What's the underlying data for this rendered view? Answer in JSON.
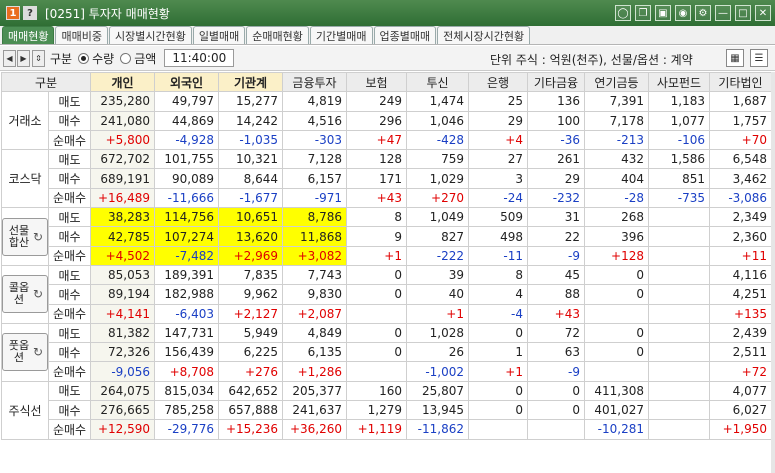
{
  "window": {
    "num_badge": "1",
    "help_badge": "?",
    "title": "[0251] 투자자 매매현황",
    "icons": [
      "lock-icon",
      "copy-icon",
      "save-icon",
      "camera-icon",
      "gear-icon",
      "minimize-icon",
      "maximize-icon",
      "close-icon"
    ]
  },
  "tabs": [
    "매매현황",
    "매매비중",
    "시장별시간현황",
    "일별매매",
    "순매매현황",
    "기간별매매",
    "업종별매매",
    "전체시장시간현황"
  ],
  "toolbar": {
    "gubun_label": "구분",
    "radio_qty": "수량",
    "radio_amount": "금액",
    "time": "11:40:00",
    "unit_text": "단위 주식 : 억원(천주), 선물/옵션 : 계약"
  },
  "table": {
    "columns": [
      "구분",
      "개인",
      "외국인",
      "기관계",
      "금융투자",
      "보험",
      "투신",
      "은행",
      "기타금융",
      "연기금등",
      "사모펀드",
      "기타법인"
    ],
    "row_labels": [
      "매도",
      "매수",
      "순매수"
    ],
    "groups": [
      {
        "name": "거래소",
        "button": false,
        "rows": [
          [
            "235,280",
            "49,797",
            "15,277",
            "4,819",
            "249",
            "1,474",
            "25",
            "136",
            "7,391",
            "1,183",
            "1,687"
          ],
          [
            "241,080",
            "44,869",
            "14,242",
            "4,516",
            "296",
            "1,046",
            "29",
            "100",
            "7,178",
            "1,077",
            "1,757"
          ],
          [
            "+5,800",
            "-4,928",
            "-1,035",
            "-303",
            "+47",
            "-428",
            "+4",
            "-36",
            "-213",
            "-106",
            "+70"
          ]
        ]
      },
      {
        "name": "코스닥",
        "button": false,
        "rows": [
          [
            "672,702",
            "101,755",
            "10,321",
            "7,128",
            "128",
            "759",
            "27",
            "261",
            "432",
            "1,586",
            "6,548"
          ],
          [
            "689,191",
            "90,089",
            "8,644",
            "6,157",
            "171",
            "1,029",
            "3",
            "29",
            "404",
            "851",
            "3,462"
          ],
          [
            "+16,489",
            "-11,666",
            "-1,677",
            "-971",
            "+43",
            "+270",
            "-24",
            "-232",
            "-28",
            "-735",
            "-3,086"
          ]
        ]
      },
      {
        "name": "선물합산",
        "button": true,
        "yellow": true,
        "rows": [
          [
            "38,283",
            "114,756",
            "10,651",
            "8,786",
            "8",
            "1,049",
            "509",
            "31",
            "268",
            "",
            "2,349"
          ],
          [
            "42,785",
            "107,274",
            "13,620",
            "11,868",
            "9",
            "827",
            "498",
            "22",
            "396",
            "",
            "2,360"
          ],
          [
            "+4,502",
            "-7,482",
            "+2,969",
            "+3,082",
            "+1",
            "-222",
            "-11",
            "-9",
            "+128",
            "",
            "+11"
          ]
        ]
      },
      {
        "name": "콜옵션",
        "button": true,
        "rows": [
          [
            "85,053",
            "189,391",
            "7,835",
            "7,743",
            "0",
            "39",
            "8",
            "45",
            "0",
            "",
            "4,116"
          ],
          [
            "89,194",
            "182,988",
            "9,962",
            "9,830",
            "0",
            "40",
            "4",
            "88",
            "0",
            "",
            "4,251"
          ],
          [
            "+4,141",
            "-6,403",
            "+2,127",
            "+2,087",
            "",
            "+1",
            "-4",
            "+43",
            "",
            "",
            "+135"
          ]
        ]
      },
      {
        "name": "풋옵션",
        "button": true,
        "rows": [
          [
            "81,382",
            "147,731",
            "5,949",
            "4,849",
            "0",
            "1,028",
            "0",
            "72",
            "0",
            "",
            "2,439"
          ],
          [
            "72,326",
            "156,439",
            "6,225",
            "6,135",
            "0",
            "26",
            "1",
            "63",
            "0",
            "",
            "2,511"
          ],
          [
            "-9,056",
            "+8,708",
            "+276",
            "+1,286",
            "",
            "-1,002",
            "+1",
            "-9",
            "",
            "",
            "+72"
          ]
        ]
      },
      {
        "name": "주식선",
        "button": false,
        "rows": [
          [
            "264,075",
            "815,034",
            "642,652",
            "205,377",
            "160",
            "25,807",
            "0",
            "0",
            "411,308",
            "",
            "4,077"
          ],
          [
            "276,665",
            "785,258",
            "657,888",
            "241,637",
            "1,279",
            "13,945",
            "0",
            "0",
            "401,027",
            "",
            "6,027"
          ],
          [
            "+12,590",
            "-29,776",
            "+15,236",
            "+36,260",
            "+1,119",
            "-11,862",
            "",
            "",
            "-10,281",
            "",
            "+1,950"
          ]
        ]
      }
    ]
  },
  "colors": {
    "positive": "#e00000",
    "negative": "#1a3fc4",
    "highlight": "#ffff00",
    "titlebar": "#2f6e34"
  }
}
